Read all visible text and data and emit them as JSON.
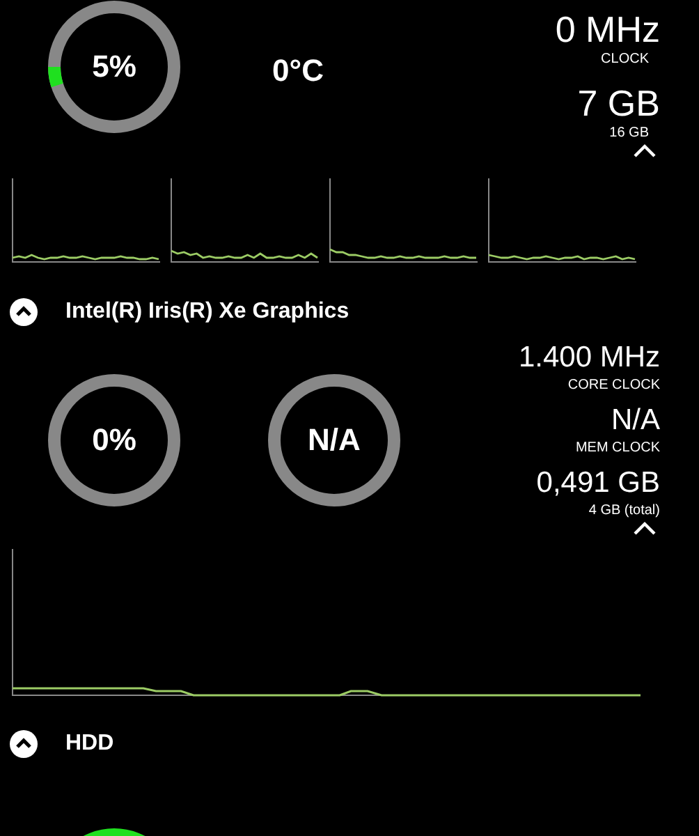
{
  "cpu": {
    "gauges": [
      {
        "reading": "5%",
        "active": true
      }
    ],
    "temperature": "0°C",
    "stats": [
      {
        "value": "0 MHz",
        "label": "CLOCK"
      },
      {
        "value": "7 GB",
        "label": "16 GB"
      }
    ]
  },
  "sections": [
    {
      "title": "Intel(R) Iris(R) Xe Graphics",
      "expanded": true,
      "gauges": [
        {
          "reading": "0%",
          "active": false
        },
        {
          "reading": "N/A",
          "active": false
        }
      ],
      "stats": [
        {
          "value": "1.400 MHz",
          "label": "CORE CLOCK"
        },
        {
          "value": "N/A",
          "label": "MEM CLOCK"
        },
        {
          "value": "0,491 GB",
          "label": "4 GB (total)"
        }
      ]
    },
    {
      "title": "HDD",
      "expanded": true
    }
  ]
}
